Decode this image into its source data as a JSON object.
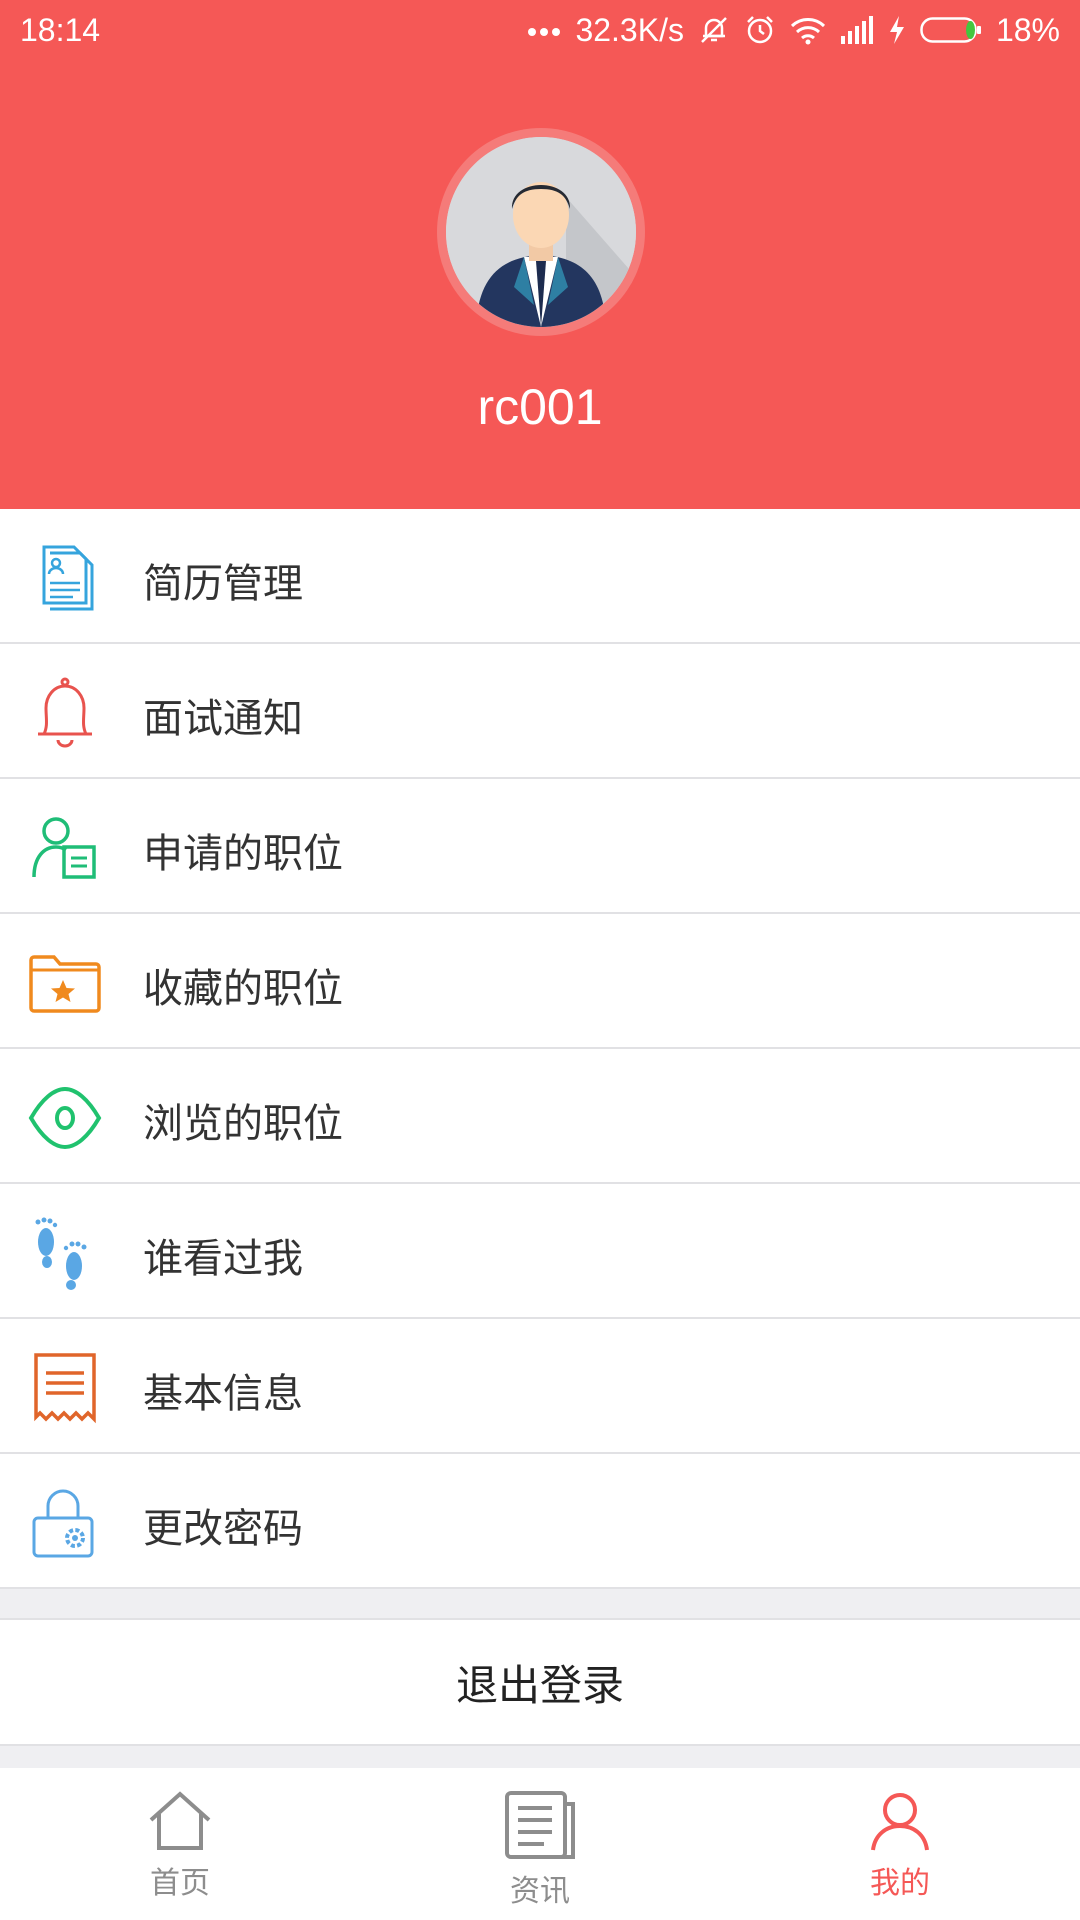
{
  "status_bar": {
    "time": "18:14",
    "network_speed": "32.3K/s",
    "battery_percent": "18%",
    "battery_level": 0.18,
    "icons": [
      "dots-icon",
      "mute-icon",
      "alarm-icon",
      "wifi-icon",
      "signal-icon",
      "charging-icon",
      "battery-icon"
    ]
  },
  "profile": {
    "username": "rc001",
    "avatar": "avatar-businessman"
  },
  "menu": {
    "items": [
      {
        "label": "简历管理",
        "icon": "resume-icon",
        "color": "#35a4dd"
      },
      {
        "label": "面试通知",
        "icon": "bell-icon",
        "color": "#e8534e"
      },
      {
        "label": "申请的职位",
        "icon": "applied-jobs-icon",
        "color": "#1fbd77"
      },
      {
        "label": "收藏的职位",
        "icon": "favorite-folder-icon",
        "color": "#f08a1e"
      },
      {
        "label": "浏览的职位",
        "icon": "eye-icon",
        "color": "#20c26e"
      },
      {
        "label": "谁看过我",
        "icon": "footprints-icon",
        "color": "#5aa7e4"
      },
      {
        "label": "基本信息",
        "icon": "receipt-icon",
        "color": "#e0652a"
      },
      {
        "label": "更改密码",
        "icon": "lock-gear-icon",
        "color": "#5aa7e4"
      }
    ]
  },
  "logout": {
    "label": "退出登录"
  },
  "tabbar": {
    "accent": "#f55856",
    "tabs": [
      {
        "label": "首页",
        "icon": "home-icon",
        "active": false
      },
      {
        "label": "资讯",
        "icon": "news-icon",
        "active": false
      },
      {
        "label": "我的",
        "icon": "profile-icon",
        "active": true
      }
    ]
  }
}
